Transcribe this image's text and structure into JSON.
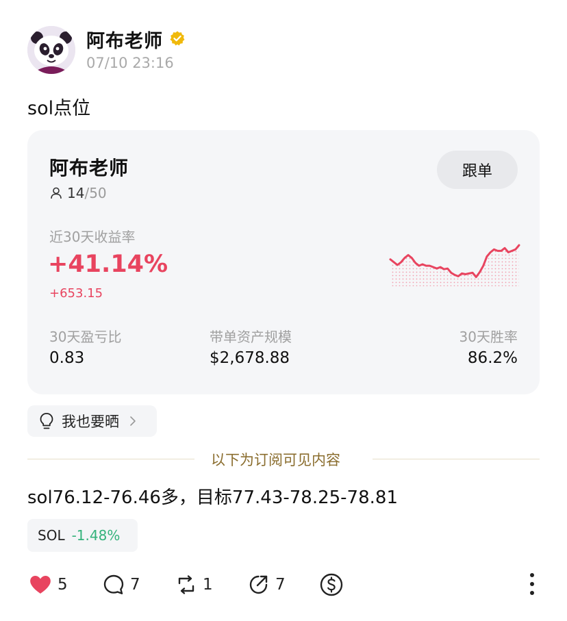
{
  "post": {
    "author": "阿布老师",
    "timestamp": "07/10 23:16",
    "title": "sol点位"
  },
  "card": {
    "name": "阿布老师",
    "followers_current": "14",
    "followers_max": "/50",
    "follow_label": "跟单",
    "return_label": "近30天收益率",
    "return_value": "+41.14%",
    "return_abs": "+653.15",
    "stats": [
      {
        "label": "30天盈亏比",
        "value": "0.83"
      },
      {
        "label": "带单资产规模",
        "value": "$2,678.88"
      },
      {
        "label": "30天胜率",
        "value": "86.2%"
      }
    ],
    "sparkline": [
      0.38,
      0.34,
      0.3,
      0.34,
      0.4,
      0.44,
      0.4,
      0.33,
      0.29,
      0.31,
      0.29,
      0.29,
      0.27,
      0.25,
      0.27,
      0.24,
      0.25,
      0.19,
      0.16,
      0.14,
      0.18,
      0.17,
      0.18,
      0.19,
      0.13,
      0.2,
      0.29,
      0.42,
      0.48,
      0.52,
      0.5,
      0.5,
      0.54,
      0.48,
      0.5,
      0.52,
      0.58
    ],
    "colors": {
      "up": "#e8445f",
      "down": "#34b27b"
    }
  },
  "share_label": "我也要晒",
  "divider_text": "以下为订阅可见内容",
  "content": "sol76.12-76.46多，目标77.43-78.25-78.81",
  "tag": {
    "symbol": "SOL",
    "change": "-1.48%"
  },
  "actions": {
    "likes": "5",
    "comments": "7",
    "reposts": "1",
    "shares": "7"
  }
}
